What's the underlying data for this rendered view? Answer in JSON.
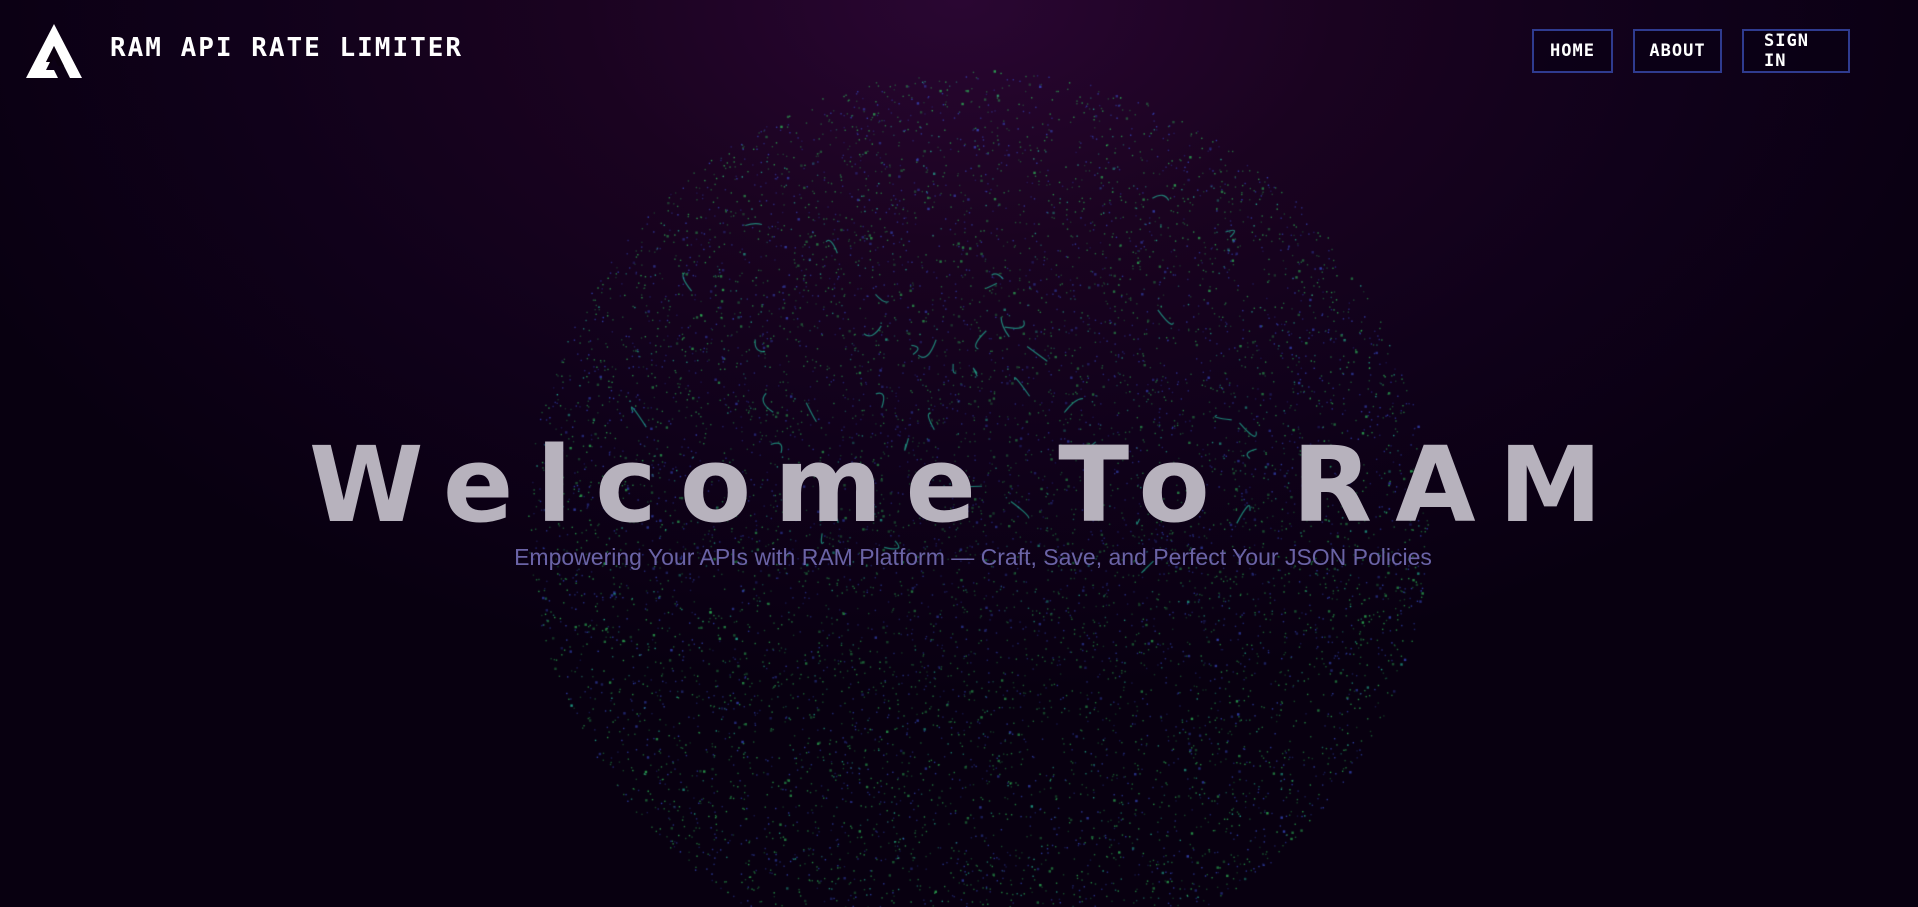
{
  "header": {
    "brand_title": "RAM API RATE LIMITER",
    "logo_icon": "ram-logo-icon"
  },
  "nav": {
    "items": [
      {
        "label": "HOME"
      },
      {
        "label": "ABOUT"
      },
      {
        "label": "SIGN IN"
      }
    ]
  },
  "hero": {
    "title": "Welcome To RAM",
    "subtitle": "Empowering Your APIs with RAM Platform — Craft, Save, and Perfect Your JSON Policies"
  },
  "colors": {
    "background_top": "#2a0632",
    "background_bottom": "#080010",
    "nav_border": "#2f3b8f",
    "title": "#b7b2bd",
    "subtitle": "#6a63a6",
    "particle_green": "#2fbf5a",
    "particle_blue": "#3a4fd0",
    "particle_cyan": "#27d6b0"
  }
}
